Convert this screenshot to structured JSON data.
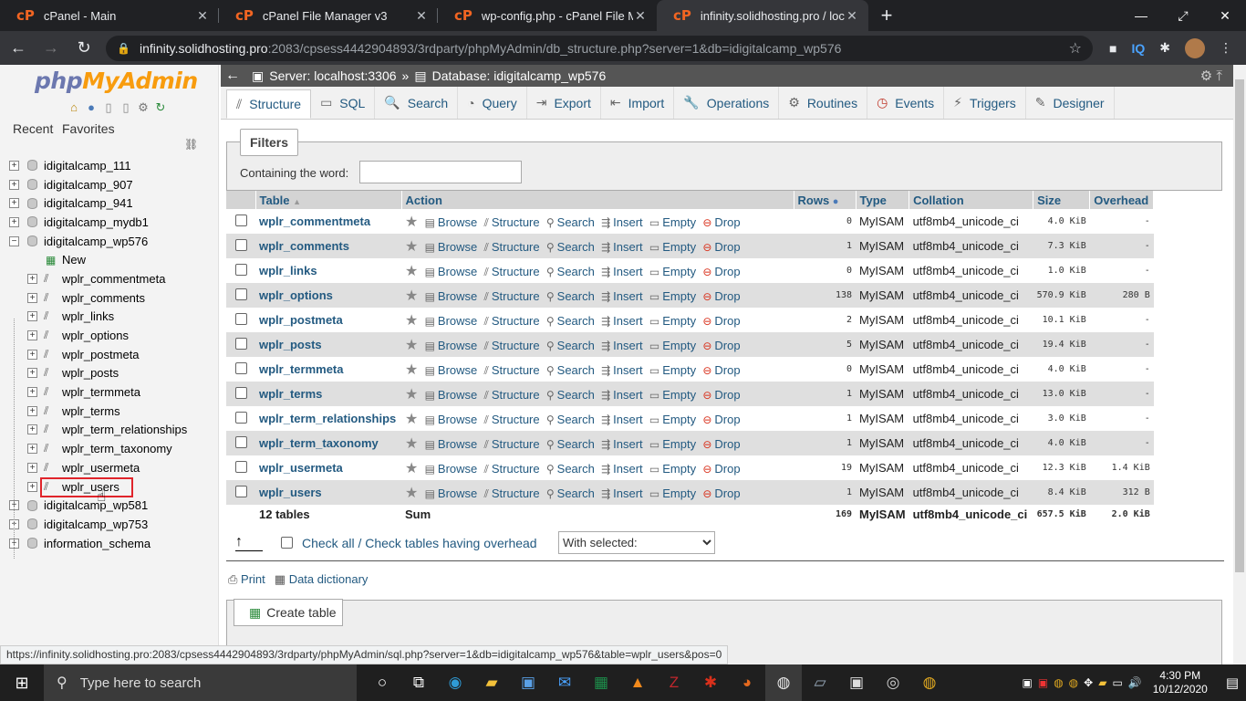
{
  "browser": {
    "tabs": [
      {
        "title": "cPanel - Main",
        "active": false
      },
      {
        "title": "cPanel File Manager v3",
        "active": false
      },
      {
        "title": "wp-config.php - cPanel File Mana",
        "active": false
      },
      {
        "title": "infinity.solidhosting.pro / localho",
        "active": true
      }
    ],
    "url_host": "infinity.solidhosting.pro",
    "url_rest": ":2083/cpsess4442904893/3rdparty/phpMyAdmin/db_structure.php?server=1&db=idigitalcamp_wp576"
  },
  "sidebar": {
    "logo_php": "php",
    "logo_my": "MyAdmin",
    "recent": "Recent",
    "favorites": "Favorites",
    "databases_top": [
      "idigitalcamp_111",
      "idigitalcamp_907",
      "idigitalcamp_941",
      "idigitalcamp_mydb1",
      "idigitalcamp_wp576"
    ],
    "new_label": "New",
    "tables": [
      "wplr_commentmeta",
      "wplr_comments",
      "wplr_links",
      "wplr_options",
      "wplr_postmeta",
      "wplr_posts",
      "wplr_termmeta",
      "wplr_terms",
      "wplr_term_relationships",
      "wplr_term_taxonomy",
      "wplr_usermeta",
      "wplr_users"
    ],
    "databases_bottom": [
      "idigitalcamp_wp581",
      "idigitalcamp_wp753",
      "information_schema"
    ]
  },
  "breadcrumb": {
    "server": "Server: localhost:3306",
    "sep": "»",
    "database": "Database: idigitalcamp_wp576"
  },
  "tabs": [
    "Structure",
    "SQL",
    "Search",
    "Query",
    "Export",
    "Import",
    "Operations",
    "Routines",
    "Events",
    "Triggers",
    "Designer"
  ],
  "filters": {
    "legend": "Filters",
    "label": "Containing the word:",
    "value": ""
  },
  "table": {
    "headers": {
      "table": "Table",
      "action": "Action",
      "rows": "Rows",
      "type": "Type",
      "collation": "Collation",
      "size": "Size",
      "overhead": "Overhead"
    },
    "actions": {
      "browse": "Browse",
      "structure": "Structure",
      "search": "Search",
      "insert": "Insert",
      "empty": "Empty",
      "drop": "Drop"
    },
    "rows": [
      {
        "name": "wplr_commentmeta",
        "rows": "0",
        "type": "MyISAM",
        "collation": "utf8mb4_unicode_ci",
        "size": "4.0 KiB",
        "overhead": "-"
      },
      {
        "name": "wplr_comments",
        "rows": "1",
        "type": "MyISAM",
        "collation": "utf8mb4_unicode_ci",
        "size": "7.3 KiB",
        "overhead": "-"
      },
      {
        "name": "wplr_links",
        "rows": "0",
        "type": "MyISAM",
        "collation": "utf8mb4_unicode_ci",
        "size": "1.0 KiB",
        "overhead": "-"
      },
      {
        "name": "wplr_options",
        "rows": "138",
        "type": "MyISAM",
        "collation": "utf8mb4_unicode_ci",
        "size": "570.9 KiB",
        "overhead": "280 B"
      },
      {
        "name": "wplr_postmeta",
        "rows": "2",
        "type": "MyISAM",
        "collation": "utf8mb4_unicode_ci",
        "size": "10.1 KiB",
        "overhead": "-"
      },
      {
        "name": "wplr_posts",
        "rows": "5",
        "type": "MyISAM",
        "collation": "utf8mb4_unicode_ci",
        "size": "19.4 KiB",
        "overhead": "-"
      },
      {
        "name": "wplr_termmeta",
        "rows": "0",
        "type": "MyISAM",
        "collation": "utf8mb4_unicode_ci",
        "size": "4.0 KiB",
        "overhead": "-"
      },
      {
        "name": "wplr_terms",
        "rows": "1",
        "type": "MyISAM",
        "collation": "utf8mb4_unicode_ci",
        "size": "13.0 KiB",
        "overhead": "-"
      },
      {
        "name": "wplr_term_relationships",
        "rows": "1",
        "type": "MyISAM",
        "collation": "utf8mb4_unicode_ci",
        "size": "3.0 KiB",
        "overhead": "-"
      },
      {
        "name": "wplr_term_taxonomy",
        "rows": "1",
        "type": "MyISAM",
        "collation": "utf8mb4_unicode_ci",
        "size": "4.0 KiB",
        "overhead": "-"
      },
      {
        "name": "wplr_usermeta",
        "rows": "19",
        "type": "MyISAM",
        "collation": "utf8mb4_unicode_ci",
        "size": "12.3 KiB",
        "overhead": "1.4 KiB"
      },
      {
        "name": "wplr_users",
        "rows": "1",
        "type": "MyISAM",
        "collation": "utf8mb4_unicode_ci",
        "size": "8.4 KiB",
        "overhead": "312 B"
      }
    ],
    "summary": {
      "count": "12 tables",
      "label": "Sum",
      "rows": "169",
      "type": "MyISAM",
      "collation": "utf8mb4_unicode_ci",
      "size": "657.5 KiB",
      "overhead": "2.0 KiB"
    }
  },
  "bulk": {
    "check_all": "Check all / Check tables having overhead",
    "with_selected": "With selected:"
  },
  "print": "Print",
  "data_dictionary": "Data dictionary",
  "create_table": "Create table",
  "status_url": "https://infinity.solidhosting.pro:2083/cpsess4442904893/3rdparty/phpMyAdmin/sql.php?server=1&db=idigitalcamp_wp576&table=wplr_users&pos=0",
  "taskbar": {
    "search_placeholder": "Type here to search",
    "time": "4:30 PM",
    "date": "10/12/2020"
  }
}
